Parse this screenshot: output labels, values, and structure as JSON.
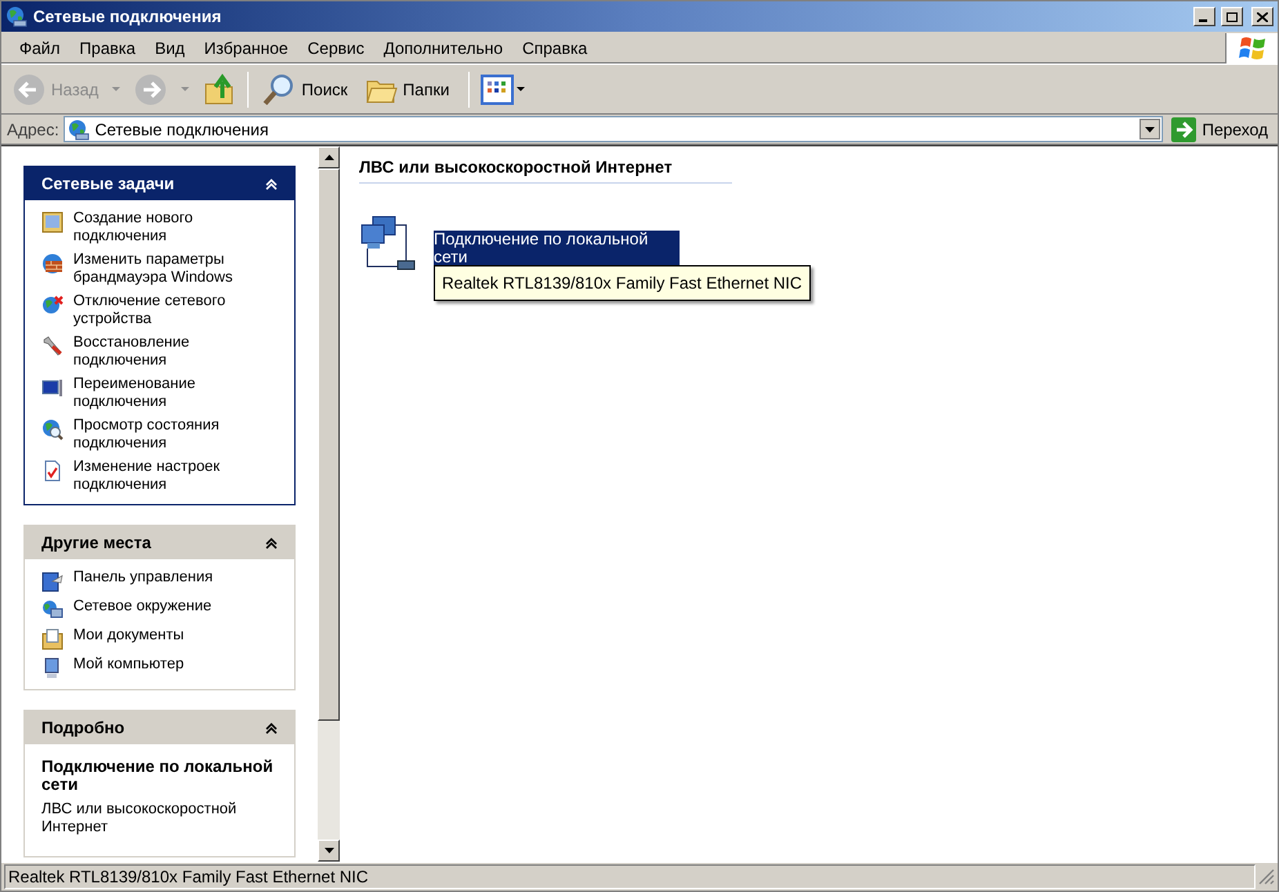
{
  "window": {
    "title": "Сетевые подключения"
  },
  "menu": [
    {
      "label": "Файл"
    },
    {
      "label": "Правка"
    },
    {
      "label": "Вид"
    },
    {
      "label": "Избранное"
    },
    {
      "label": "Сервис"
    },
    {
      "label": "Дополнительно"
    },
    {
      "label": "Справка"
    }
  ],
  "toolbar": {
    "back": {
      "label": "Назад",
      "disabled": true
    },
    "forward": {
      "disabled": true
    },
    "buttons": [
      {
        "label": "Поиск",
        "kind": "search"
      },
      {
        "label": "Папки",
        "kind": "folders"
      }
    ]
  },
  "address": {
    "label": "Адрес:",
    "value": "Сетевые подключения",
    "go": "Переход"
  },
  "sidebar": [
    {
      "title": "Сетевые задачи",
      "kind": "special",
      "items": [
        {
          "label": "Создание нового подключения",
          "kind": "wizard"
        },
        {
          "label": "Изменить параметры брандмауэра Windows",
          "kind": "firewall"
        },
        {
          "label": "Отключение сетевого устройства",
          "kind": "disable"
        },
        {
          "label": "Восстановление подключения",
          "kind": "repair"
        },
        {
          "label": "Переименование подключения",
          "kind": "rename"
        },
        {
          "label": "Просмотр состояния подключения",
          "kind": "status"
        },
        {
          "label": "Изменение настроек подключения",
          "kind": "settings"
        }
      ]
    },
    {
      "title": "Другие места",
      "kind": "normal",
      "items": [
        {
          "label": "Панель управления",
          "kind": "control"
        },
        {
          "label": "Сетевое окружение",
          "kind": "network"
        },
        {
          "label": "Мои документы",
          "kind": "documents"
        },
        {
          "label": "Мой компьютер",
          "kind": "computer"
        }
      ]
    },
    {
      "title": "Подробно",
      "kind": "details",
      "name": "Подключение по локальной сети",
      "description": "ЛВС или высокоскоростной Интернет"
    }
  ],
  "content": {
    "group_title": "ЛВС или высокоскоростной Интернет",
    "items": [
      {
        "label": "Подключение по локальной сети",
        "selected": true
      }
    ]
  },
  "tooltip": "Realtek RTL8139/810x Family Fast Ethernet NIC",
  "status_bar": "Realtek RTL8139/810x Family Fast Ethernet NIC"
}
